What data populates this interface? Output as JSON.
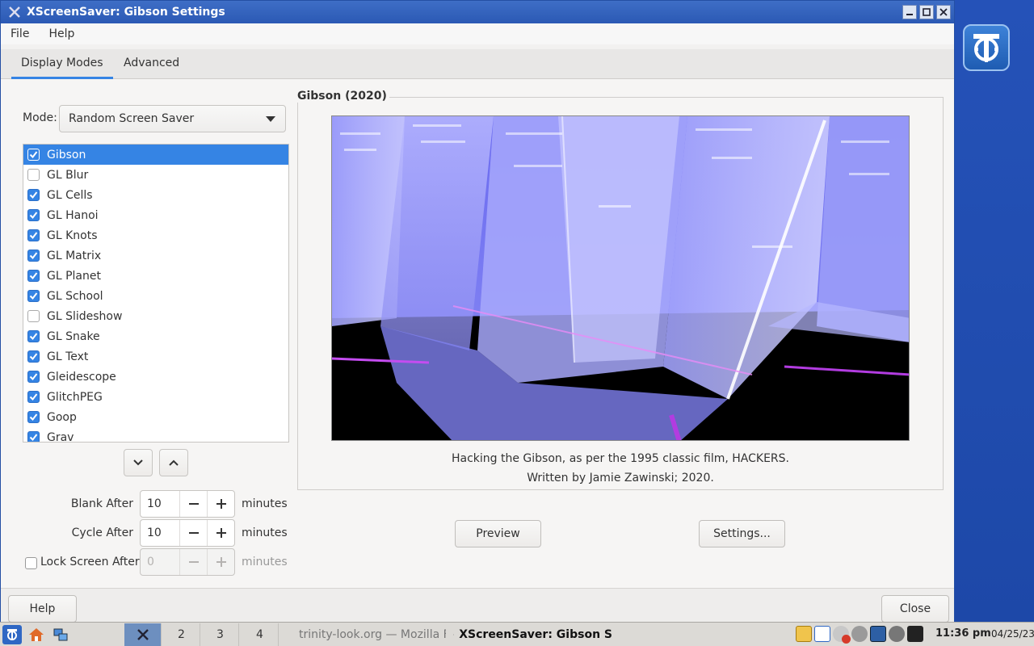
{
  "window": {
    "title": "XScreenSaver: Gibson Settings"
  },
  "menu": {
    "file": "File",
    "help": "Help"
  },
  "tabs": {
    "display_modes": "Display Modes",
    "advanced": "Advanced"
  },
  "mode": {
    "label": "Mode:",
    "value": "Random Screen Saver"
  },
  "hacks": [
    {
      "name": "Gibson",
      "checked": true,
      "selected": true
    },
    {
      "name": "GL Blur",
      "checked": false
    },
    {
      "name": "GL Cells",
      "checked": true
    },
    {
      "name": "GL Hanoi",
      "checked": true
    },
    {
      "name": "GL Knots",
      "checked": true
    },
    {
      "name": "GL Matrix",
      "checked": true
    },
    {
      "name": "GL Planet",
      "checked": true
    },
    {
      "name": "GL School",
      "checked": true
    },
    {
      "name": "GL Slideshow",
      "checked": false
    },
    {
      "name": "GL Snake",
      "checked": true
    },
    {
      "name": "GL Text",
      "checked": true
    },
    {
      "name": "Gleidescope",
      "checked": true
    },
    {
      "name": "GlitchPEG",
      "checked": true
    },
    {
      "name": "Goop",
      "checked": true
    },
    {
      "name": "Grav",
      "checked": true
    }
  ],
  "timing": {
    "blank_after": {
      "label": "Blank After",
      "value": "10",
      "unit": "minutes"
    },
    "cycle_after": {
      "label": "Cycle After",
      "value": "10",
      "unit": "minutes"
    },
    "lock_after": {
      "label": "Lock Screen After",
      "value": "0",
      "unit": "minutes",
      "enabled": false
    }
  },
  "preview": {
    "title": "Gibson (2020)",
    "description_line1": "Hacking the Gibson, as per the 1995 classic film, HACKERS.",
    "description_line2": "Written by Jamie Zawinski; 2020.",
    "preview_button": "Preview",
    "settings_button": "Settings..."
  },
  "footer": {
    "help_button": "Help",
    "close_button": "Close"
  },
  "taskbar": {
    "desktops": [
      "2",
      "3",
      "4"
    ],
    "tasks": [
      {
        "label": "trinity-look.org — Mozilla F",
        "active": false
      },
      {
        "label": "XScreenSaver: Gibson S",
        "active": true
      }
    ],
    "clock": "11:36 pm",
    "date": "04/25/23"
  },
  "colors": {
    "accent": "#3584e4",
    "titlebar": "#2b59b4",
    "desktop": "#2552b8"
  }
}
